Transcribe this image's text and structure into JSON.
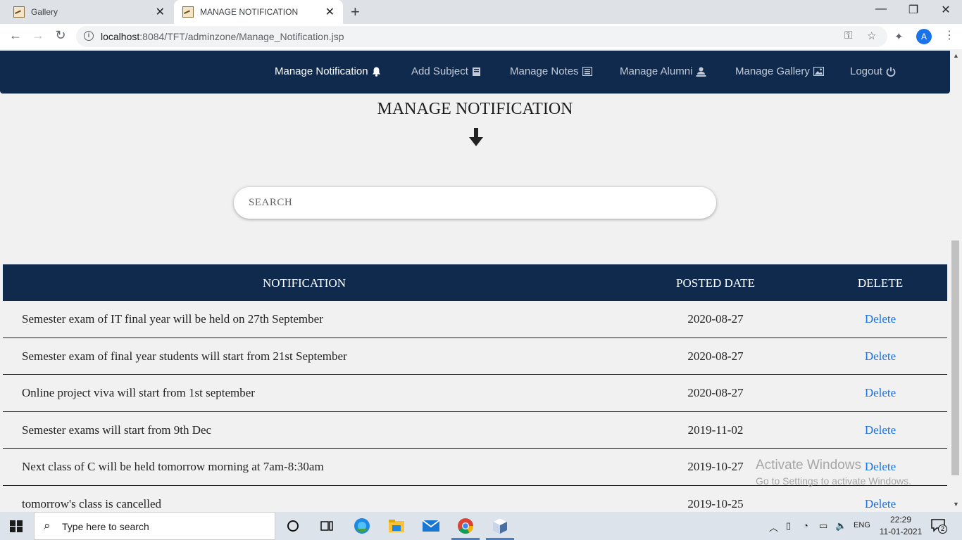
{
  "browser": {
    "tabs": [
      {
        "title": "Gallery",
        "active": false
      },
      {
        "title": "MANAGE NOTIFICATION",
        "active": true
      }
    ],
    "url_host": "localhost",
    "url_path": ":8084/TFT/adminzone/Manage_Notification.jsp",
    "profile_initial": "A"
  },
  "navbar": {
    "items": [
      {
        "label": "Manage Notification",
        "icon": "bell-icon",
        "active": true
      },
      {
        "label": "Add Subject",
        "icon": "book-icon",
        "active": false
      },
      {
        "label": "Manage Notes",
        "icon": "list-icon",
        "active": false
      },
      {
        "label": "Manage Alumni",
        "icon": "user-icon",
        "active": false
      },
      {
        "label": "Manage Gallery",
        "icon": "image-icon",
        "active": false
      },
      {
        "label": "Logout",
        "icon": "power-icon",
        "active": false
      }
    ]
  },
  "page": {
    "title": "MANAGE NOTIFICATION",
    "search_placeholder": "SEARCH"
  },
  "table": {
    "headers": {
      "notification": "NOTIFICATION",
      "posted_date": "POSTED DATE",
      "delete": "DELETE"
    },
    "rows": [
      {
        "notification": "Semester exam of IT final year will be held on 27th September",
        "date": "2020-08-27",
        "action": "Delete"
      },
      {
        "notification": "Semester exam of final year students will start from 21st September",
        "date": "2020-08-27",
        "action": "Delete"
      },
      {
        "notification": "Online project viva will start from 1st september",
        "date": "2020-08-27",
        "action": "Delete"
      },
      {
        "notification": "Semester exams will start from 9th Dec",
        "date": "2019-11-02",
        "action": "Delete"
      },
      {
        "notification": "Next class of C will be held tomorrow morning at 7am-8:30am",
        "date": "2019-10-27",
        "action": "Delete"
      },
      {
        "notification": "tomorrow's class is cancelled",
        "date": "2019-10-25",
        "action": "Delete"
      }
    ]
  },
  "watermark": {
    "line1": "Activate Windows",
    "line2": "Go to Settings to activate Windows."
  },
  "taskbar": {
    "search_placeholder": "Type here to search",
    "language": "ENG",
    "time": "22:29",
    "date": "11-01-2021",
    "notification_count": "2"
  },
  "colors": {
    "navbar_bg": "#0f2a4d",
    "link_blue": "#1a73e8",
    "page_bg": "#f1f1f1"
  }
}
